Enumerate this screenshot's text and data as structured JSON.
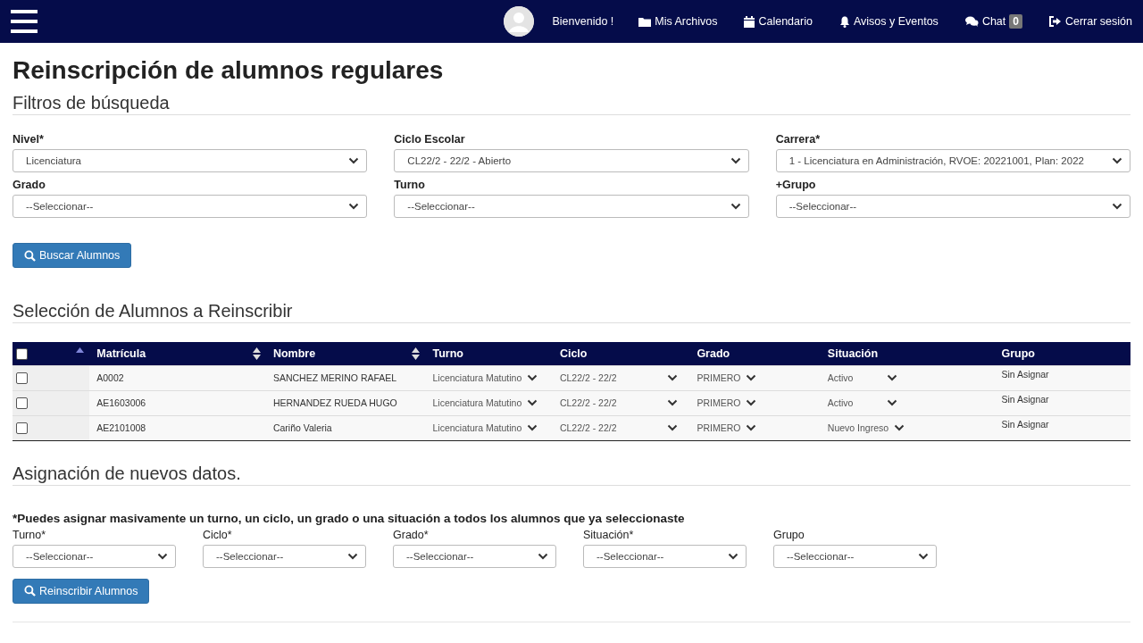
{
  "navbar": {
    "greeting": "Bienvenido !",
    "links": [
      {
        "kind": "folder",
        "label": "Mis Archivos"
      },
      {
        "kind": "calendar",
        "label": "Calendario"
      },
      {
        "kind": "bell",
        "label": "Avisos y Eventos"
      },
      {
        "kind": "chat",
        "label": "Chat",
        "badge": "0"
      },
      {
        "kind": "signout",
        "label": "Cerrar sesión"
      }
    ]
  },
  "page_title": "Reinscripción de alumnos regulares",
  "filters": {
    "heading": "Filtros de búsqueda",
    "fields": [
      {
        "label": "Nivel*",
        "value": "Licenciatura"
      },
      {
        "label": "Ciclo Escolar",
        "value": "CL22/2 - 22/2 - Abierto"
      },
      {
        "label": "Carrera*",
        "value": "1 - Licenciatura en Administración, RVOE: 20221001, Plan: 2022"
      },
      {
        "label": "Grado",
        "value": "--Seleccionar--"
      },
      {
        "label": "Turno",
        "value": "--Seleccionar--"
      },
      {
        "label": "+Grupo",
        "value": "--Seleccionar--"
      }
    ],
    "button": "Buscar Alumnos"
  },
  "selection": {
    "heading": "Selección de Alumnos a Reinscribir",
    "table": {
      "select_all_checked": false,
      "columns": [
        {
          "sortable": true,
          "sorted": true
        },
        {
          "label": "Matrícula",
          "sortable": true,
          "sorted": false
        },
        {
          "label": "Nombre",
          "sortable": true,
          "sorted": false
        },
        {
          "label": "Turno",
          "sortable": false,
          "sorted": false
        },
        {
          "label": "Ciclo",
          "sortable": false,
          "sorted": false
        },
        {
          "label": "Grado",
          "sortable": false,
          "sorted": false
        },
        {
          "label": "Situación",
          "sortable": false,
          "sorted": false
        },
        {
          "label": "Grupo",
          "sortable": false,
          "sorted": false
        }
      ],
      "rows": [
        {
          "checked": false,
          "matricula": "A0002",
          "nombre": "SANCHEZ MERINO RAFAEL",
          "turno": "Licenciatura Matutino",
          "ciclo": "CL22/2 - 22/2",
          "grado": "PRIMERO",
          "situacion": "Activo",
          "grupo": "Sin Asignar"
        },
        {
          "checked": false,
          "matricula": "AE1603006",
          "nombre": "HERNANDEZ RUEDA HUGO",
          "turno": "Licenciatura Matutino",
          "ciclo": "CL22/2 - 22/2",
          "grado": "PRIMERO",
          "situacion": "Activo",
          "grupo": "Sin Asignar"
        },
        {
          "checked": false,
          "matricula": "AE2101008",
          "nombre": "Cariño Valeria",
          "turno": "Licenciatura Matutino",
          "ciclo": "CL22/2 - 22/2",
          "grado": "PRIMERO",
          "situacion": "Nuevo Ingreso",
          "grupo": "Sin Asignar"
        }
      ]
    }
  },
  "assignment": {
    "heading": "Asignación de nuevos datos.",
    "note": "*Puedes asignar masivamente un turno, un ciclo, un grado o una situación a todos los alumnos que ya seleccionaste",
    "fields": [
      {
        "label": "Turno*",
        "value": "--Seleccionar--"
      },
      {
        "label": "Ciclo*",
        "value": "--Seleccionar--"
      },
      {
        "label": "Grado*",
        "value": "--Seleccionar--"
      },
      {
        "label": "Situación*",
        "value": "--Seleccionar--"
      },
      {
        "label": "Grupo",
        "value": "--Seleccionar--"
      }
    ],
    "button": "Reinscribir Alumnos"
  }
}
